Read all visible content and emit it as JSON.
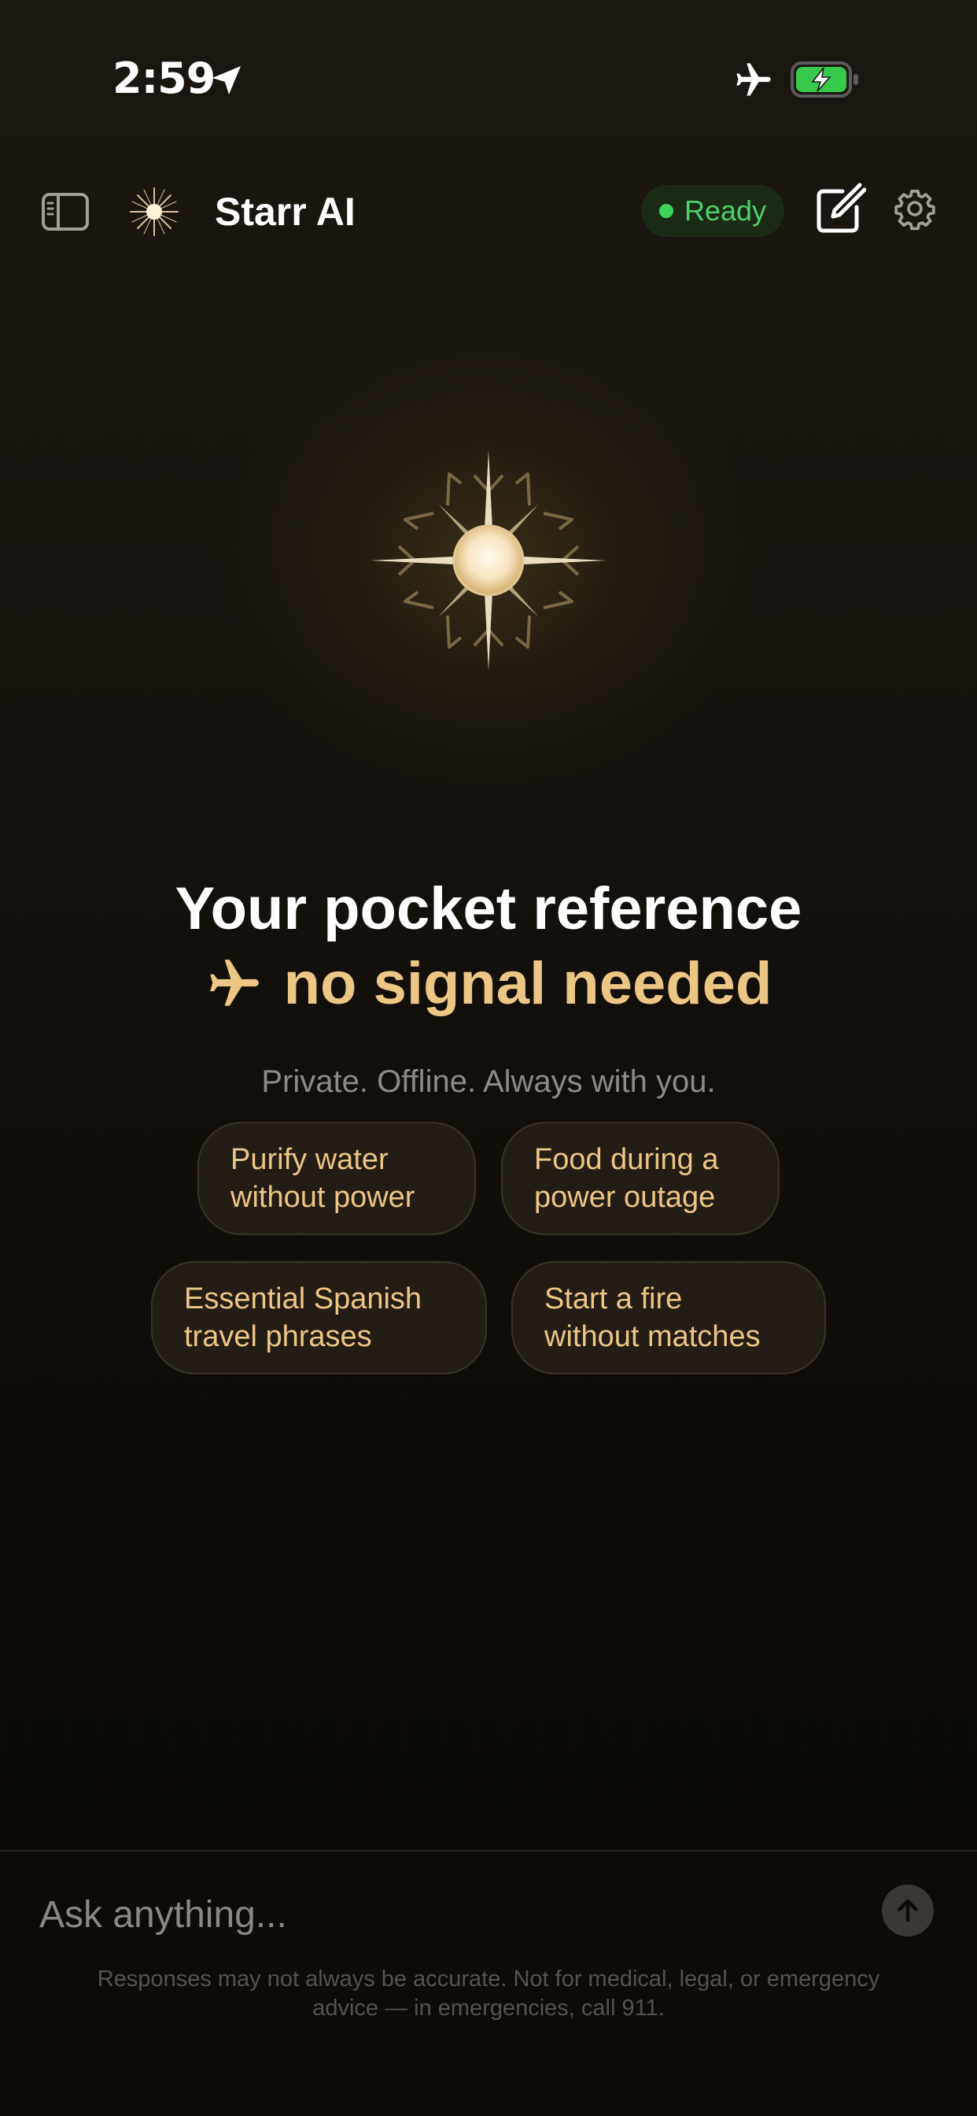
{
  "status_bar": {
    "time": "2:59",
    "icons": [
      "location-arrow-icon",
      "airplane-mode-icon",
      "battery-charging-icon"
    ]
  },
  "header": {
    "sidebar_icon": "sidebar-icon",
    "logo_icon": "starburst-logo-icon",
    "title": "Starr AI",
    "status": {
      "label": "Ready",
      "color": "#3fd35c"
    },
    "new_chat_icon": "compose-icon",
    "settings_icon": "gear-icon"
  },
  "hero": {
    "emblem_icon": "compass-star-icon",
    "headline_line1": "Your pocket reference",
    "headline_line2_icon": "airplane-icon",
    "headline_line2": "no signal needed",
    "tagline": "Private. Offline. Always with you."
  },
  "suggestions": [
    {
      "label": "Purify water\nwithout power"
    },
    {
      "label": "Food during a\npower outage"
    },
    {
      "label": "Essential Spanish\ntravel phrases"
    },
    {
      "label": "Start a fire\nwithout matches"
    }
  ],
  "composer": {
    "placeholder": "Ask anything...",
    "send_icon": "arrow-up-icon",
    "disclaimer": "Responses may not always be accurate. Not for medical, legal, or emergency advice — in emergencies, call 911."
  },
  "colors": {
    "accent": "#ecc684",
    "background": "#15110c",
    "status_green": "#3fd35c"
  }
}
